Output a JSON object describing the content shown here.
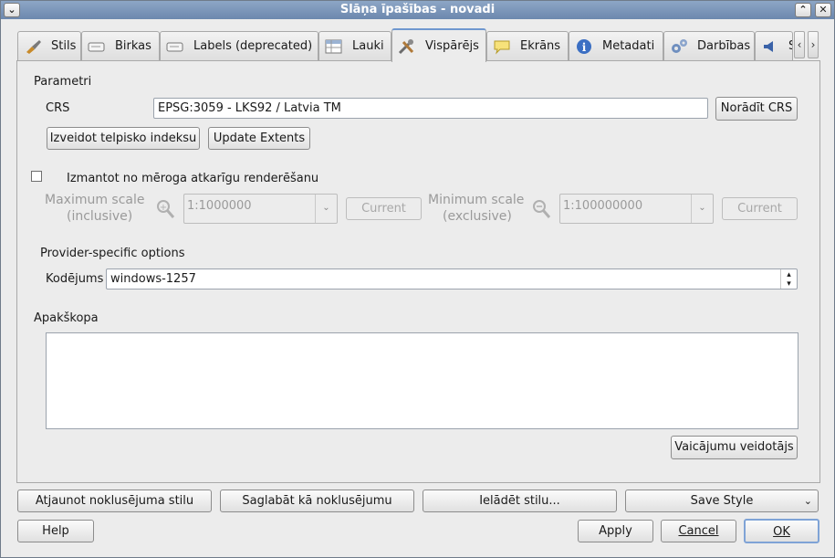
{
  "window": {
    "title": "Slāņa īpašības - novadi"
  },
  "tabs": [
    {
      "label": "Stils",
      "icon": "brush-icon"
    },
    {
      "label": "Birkas",
      "icon": "label-icon"
    },
    {
      "label": "Labels (deprecated)",
      "icon": "label-icon"
    },
    {
      "label": "Lauki",
      "icon": "table-icon"
    },
    {
      "label": "Vispārējs",
      "icon": "tools-icon",
      "active": true
    },
    {
      "label": "Ekrāns",
      "icon": "speech-bubble-icon"
    },
    {
      "label": "Metadati",
      "icon": "info-icon"
    },
    {
      "label": "Darbības",
      "icon": "gears-icon"
    },
    {
      "label": "S",
      "icon": "speaker-icon"
    }
  ],
  "general": {
    "parameters_heading": "Parametri",
    "crs_label": "CRS",
    "crs_value": "EPSG:3059 - LKS92 / Latvia TM",
    "specify_crs_button": "Norādīt CRS",
    "create_index_button": "Izveidot telpisko indeksu",
    "update_extents_button": "Update Extents",
    "scale_dependent_label": "Izmantot no mēroga atkarīgu renderēšanu",
    "scale_dependent_checked": false,
    "max_scale_label_1": "Maximum scale",
    "max_scale_label_2": "(inclusive)",
    "max_scale_value": "1:1000000",
    "min_scale_label_1": "Minimum scale",
    "min_scale_label_2": "(exclusive)",
    "min_scale_value": "1:100000000",
    "current_button": "Current",
    "provider_heading": "Provider-specific options",
    "encoding_label": "Kodējums",
    "encoding_value": "windows-1257",
    "subset_heading": "Apakškopa",
    "subset_value": "",
    "query_builder_button": "Vaicājumu veidotājs"
  },
  "bottom": {
    "restore_default": "Atjaunot noklusējuma stilu",
    "save_default": "Saglabāt kā noklusējumu",
    "load_style": "Ielādēt stilu...",
    "save_style": "Save Style",
    "help": "Help",
    "apply": "Apply",
    "cancel": "Cancel",
    "ok": "OK"
  }
}
